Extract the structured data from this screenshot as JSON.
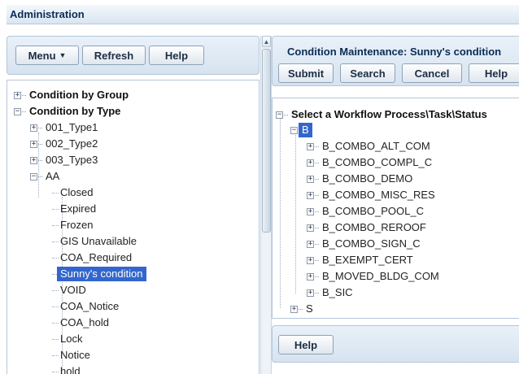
{
  "window": {
    "title": "Administration"
  },
  "left_toolbar": {
    "menu_label": "Menu",
    "refresh_label": "Refresh",
    "help_label": "Help"
  },
  "left_tree": {
    "groups": [
      {
        "label": "Condition by Group",
        "toggle": "+"
      },
      {
        "label": "Condition by Type",
        "toggle": "−"
      }
    ],
    "types": [
      {
        "label": "001_Type1",
        "toggle": "+"
      },
      {
        "label": "002_Type2",
        "toggle": "+"
      },
      {
        "label": "003_Type3",
        "toggle": "+"
      },
      {
        "label": "AA",
        "toggle": "−"
      }
    ],
    "conditions": [
      "Closed",
      "Expired",
      "Frozen",
      "GIS Unavailable",
      "COA_Required",
      "Sunny's condition",
      "VOID",
      "COA_Notice",
      "COA_hold",
      "Lock",
      "Notice",
      "hold"
    ],
    "selected_condition": "Sunny's condition"
  },
  "right_panel": {
    "title": "Condition Maintenance: Sunny's condition",
    "submit_label": "Submit",
    "search_label": "Search",
    "cancel_label": "Cancel",
    "help_label": "Help"
  },
  "right_tree": {
    "root": {
      "label": "Select a Workflow Process\\Task\\Status",
      "toggle": "−"
    },
    "process_b": {
      "label": "B",
      "toggle": "−"
    },
    "b_children": [
      "B_COMBO_ALT_COM",
      "B_COMBO_COMPL_C",
      "B_COMBO_DEMO",
      "B_COMBO_MISC_RES",
      "B_COMBO_POOL_C",
      "B_COMBO_REROOF",
      "B_COMBO_SIGN_C",
      "B_EXEMPT_CERT",
      "B_MOVED_BLDG_COM",
      "B_SIC"
    ],
    "process_s": {
      "label": "S",
      "toggle": "+"
    }
  },
  "bottom_bar": {
    "help_label": "Help"
  },
  "colors": {
    "selection": "#3366cc",
    "title_text": "#0b2c56",
    "panel_bg": "#dfe9f4"
  }
}
